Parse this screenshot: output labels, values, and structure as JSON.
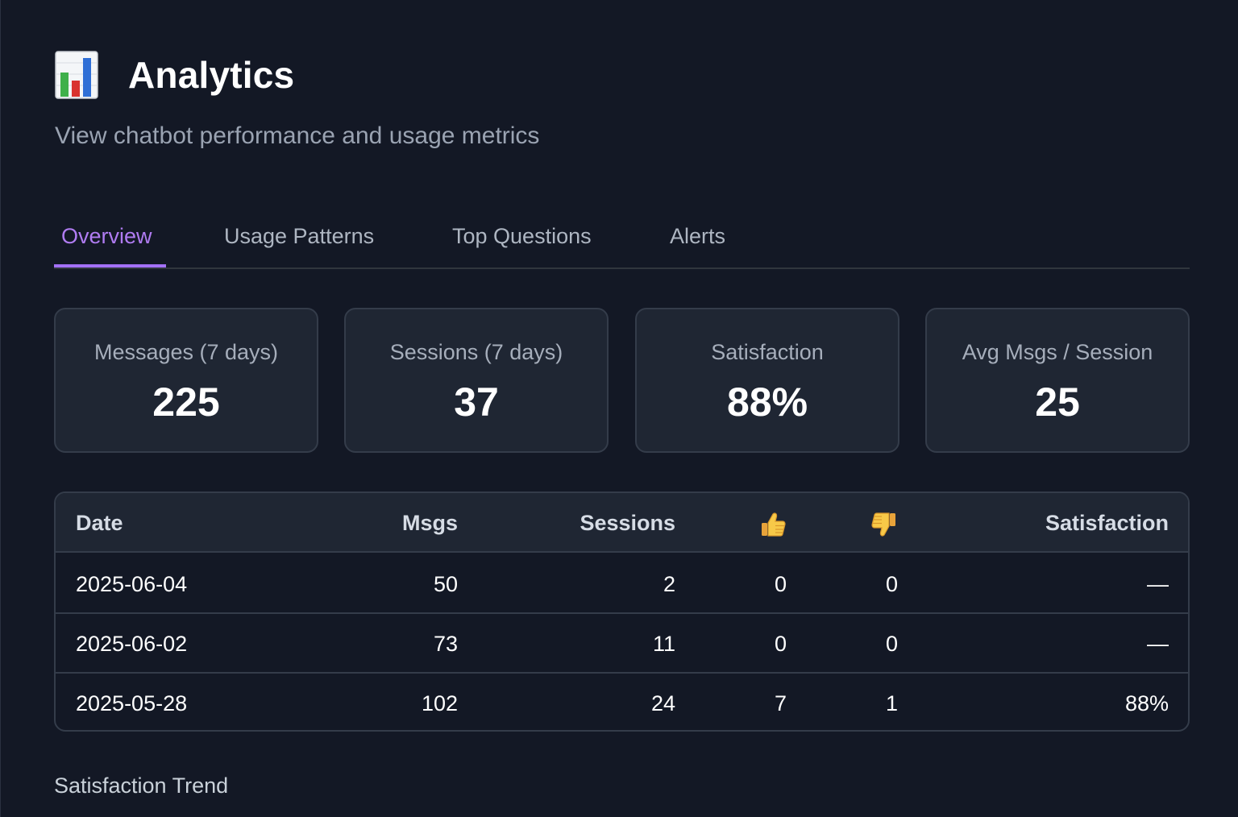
{
  "header": {
    "icon": "bar-chart-icon",
    "title": "Analytics",
    "subtitle": "View chatbot performance and usage metrics"
  },
  "tabs": [
    {
      "label": "Overview",
      "active": true
    },
    {
      "label": "Usage Patterns",
      "active": false
    },
    {
      "label": "Top Questions",
      "active": false
    },
    {
      "label": "Alerts",
      "active": false
    }
  ],
  "stats": [
    {
      "label": "Messages (7 days)",
      "value": "225"
    },
    {
      "label": "Sessions (7 days)",
      "value": "37"
    },
    {
      "label": "Satisfaction",
      "value": "88%"
    },
    {
      "label": "Avg Msgs / Session",
      "value": "25"
    }
  ],
  "table": {
    "headers": {
      "date": "Date",
      "msgs": "Msgs",
      "sessions": "Sessions",
      "thumbs_up": "thumbs-up-icon",
      "thumbs_down": "thumbs-down-icon",
      "satisfaction": "Satisfaction"
    },
    "rows": [
      {
        "date": "2025-06-04",
        "msgs": "50",
        "sessions": "2",
        "up": "0",
        "down": "0",
        "satisfaction": "—"
      },
      {
        "date": "2025-06-02",
        "msgs": "73",
        "sessions": "11",
        "up": "0",
        "down": "0",
        "satisfaction": "—"
      },
      {
        "date": "2025-05-28",
        "msgs": "102",
        "sessions": "24",
        "up": "7",
        "down": "1",
        "satisfaction": "88%"
      }
    ]
  },
  "satisfaction_trend": {
    "title": "Satisfaction Trend"
  },
  "colors": {
    "accent": "#a371f7",
    "background": "#131825",
    "card": "#1f2633"
  }
}
